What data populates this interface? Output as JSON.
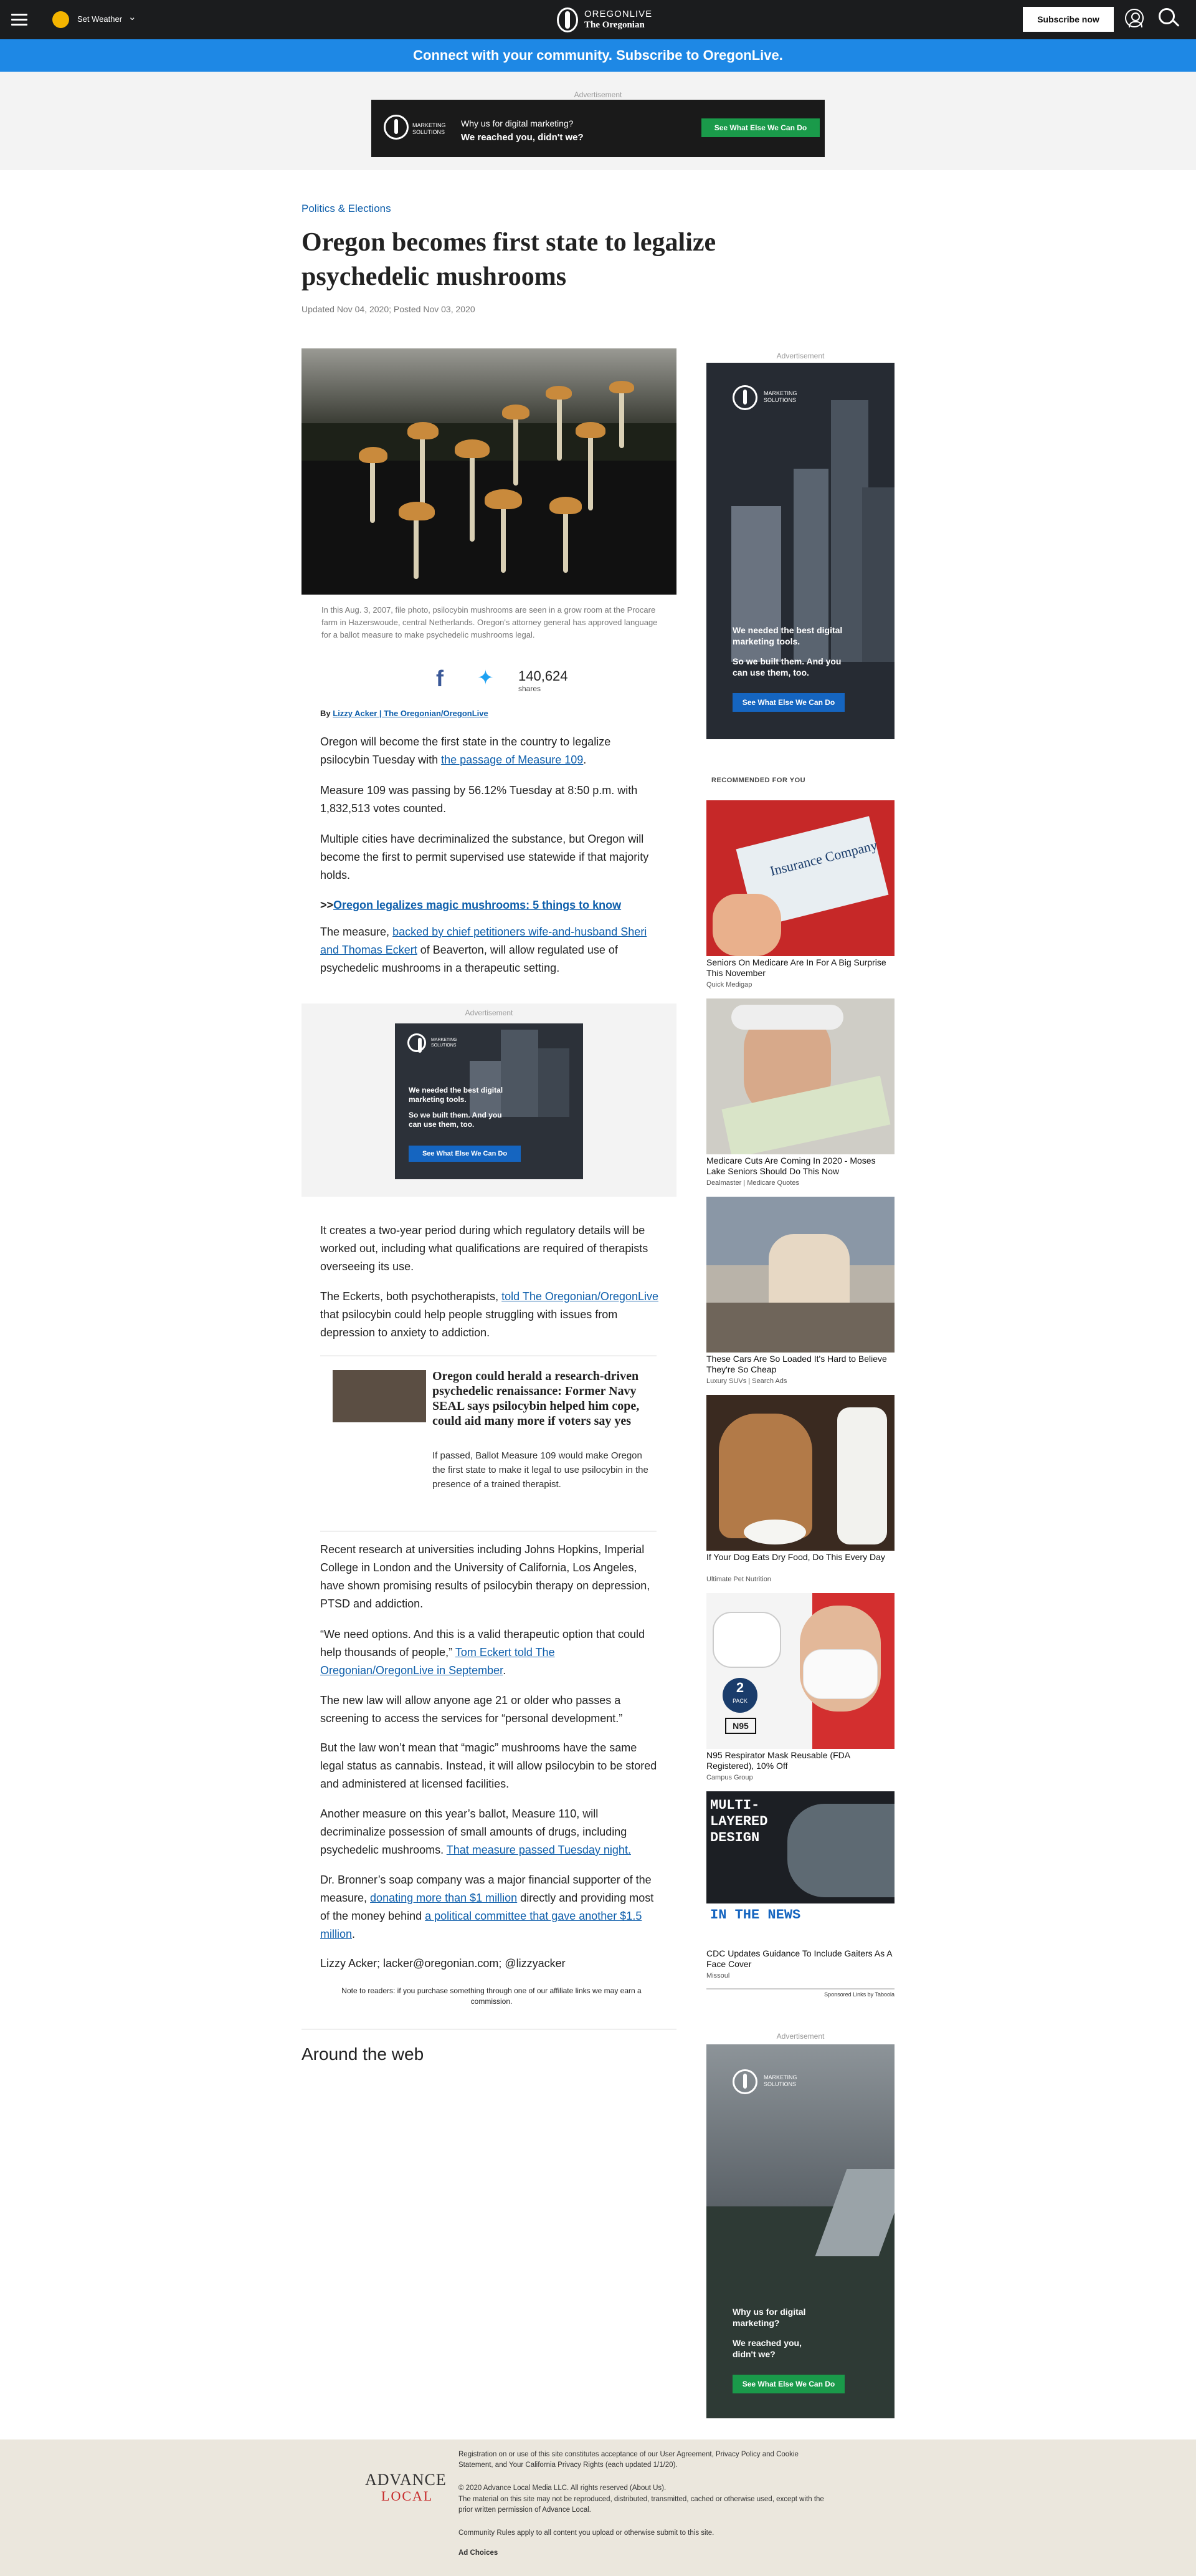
{
  "topbar": {
    "weather_label": "Set Weather",
    "logo_line1": "OREGONLIVE",
    "logo_line2": "The Oregonian",
    "subscribe_label": "Subscribe now"
  },
  "promo_bar": "Connect with your community. Subscribe to OregonLive.",
  "top_ad": {
    "label": "Advertisement",
    "brand": "MARKETING SOLUTIONS",
    "line1": "Why us for digital marketing?",
    "line2": "We reached you, didn't we?",
    "cta": "See What Else We Can Do"
  },
  "article": {
    "kicker": "Politics & Elections",
    "headline": "Oregon becomes first state to legalize psychedelic mushrooms",
    "dateline": "Updated Nov 04, 2020; Posted Nov 03, 2020",
    "caption": "In this Aug. 3, 2007, file photo, psilocybin mushrooms are seen in a grow room at the Procare farm in Hazerswoude, central Netherlands. Oregon's attorney general has approved language for a ballot measure to make psychedelic mushrooms legal.",
    "share_count": "140,624",
    "share_label": "shares",
    "by_prefix": "By",
    "by_author": "Lizzy Acker | The Oregonian/OregonLive",
    "p1_a": "Oregon will become the first state in the country to legalize psilocybin Tuesday with ",
    "p1_link": "the passage of Measure 109",
    "p1_b": ".",
    "p2": "Measure 109 was passing by 56.12% Tuesday at 8:50 p.m. with 1,832,513 votes counted.",
    "p3": "Multiple cities have decriminalized the substance, but Oregon will become the first to permit supervised use statewide if that majority holds.",
    "p4_prefix": ">>",
    "p4_link": "Oregon legalizes magic mushrooms: 5 things to know",
    "p5_a": "The measure, ",
    "p5_link": "backed by chief petitioners wife-and-husband Sheri and Thomas Eckert",
    "p5_b": " of Beaverton, will allow regulated use of psychedelic mushrooms in a therapeutic setting.",
    "p6": "It creates a two-year period during which regulatory details will be worked out, including what qualifications are required of therapists overseeing its use.",
    "p7_a": "The Eckerts, both psychotherapists, ",
    "p7_link": "told The Oregonian/OregonLive",
    "p7_b": " that psilocybin could help people struggling with issues from depression to anxiety to addiction.",
    "related_title": "Oregon could herald a research-driven psychedelic renaissance: Former Navy SEAL says psilocybin helped him cope, could aid many more if voters say yes",
    "related_summary": "If passed, Ballot Measure 109 would make Oregon the first state to make it legal to use psilocybin in the presence of a trained therapist.",
    "p8": "Recent research at universities including Johns Hopkins, Imperial College in London and the University of California, Los Angeles, have shown promising results of psilocybin therapy on depression, PTSD and addiction.",
    "p9_a": "“We need options. And this is a valid therapeutic option that could help thousands of people,” ",
    "p9_link": "Tom Eckert told The Oregonian/OregonLive in September",
    "p9_b": ".",
    "p10": "The new law will allow anyone age 21 or older who passes a screening to access the services for “personal development.”",
    "p11": "But the law won’t mean that “magic” mushrooms have the same legal status as cannabis. Instead, it will allow psilocybin to be stored and administered at licensed facilities.",
    "p12_a": "Another measure on this year’s ballot, Measure 110, will decriminalize possession of small amounts of drugs, including psychedelic mushrooms. ",
    "p12_link": "That measure passed Tuesday night.",
    "p13_a": "Dr. Bronner’s soap company was a major financial supporter of the measure, ",
    "p13_link1": "donating more than $1 million",
    "p13_b": " directly and providing most of the money behind ",
    "p13_link2": "a political committee that gave another $1.5 million",
    "p13_c": ".",
    "p14": "Lizzy Acker; lacker@oregonian.com; @lizzyacker",
    "affiliate_note": "Note to readers: if you purchase something through one of our affiliate links we may earn a commission.",
    "around_web": "Around the web"
  },
  "mid_ad": {
    "label": "Advertisement",
    "brand": "MARKETING SOLUTIONS",
    "line1": "We needed the best digital marketing tools.",
    "line2": "So we built them. And you can use them, too.",
    "cta": "See What Else We Can Do"
  },
  "side_ad1": {
    "label": "Advertisement",
    "brand": "MARKETING SOLUTIONS",
    "line1": "We needed the best digital marketing tools.",
    "line2": "So we built them. And you can use them, too.",
    "cta": "See What Else We Can Do"
  },
  "recommended": {
    "heading": "RECOMMENDED FOR YOU",
    "items": [
      {
        "title": "Seniors On Medicare Are In For A Big Surprise This November",
        "source": "Quick Medigap"
      },
      {
        "title": "Medicare Cuts Are Coming In 2020 - Moses Lake Seniors Should Do This Now",
        "source": "Dealmaster | Medicare Quotes"
      },
      {
        "title": "These Cars Are So Loaded It's Hard to Believe They're So Cheap",
        "source": "Luxury SUVs | Search Ads"
      },
      {
        "title": "If Your Dog Eats Dry Food, Do This Every Day",
        "source": "Ultimate Pet Nutrition"
      },
      {
        "title": "N95 Respirator Mask Reusable (FDA Registered), 10% Off",
        "source": "Campus Group"
      },
      {
        "title": "CDC Updates Guidance To Include Gaiters As A Face Cover",
        "source": "Missoul"
      }
    ],
    "img_text_insurance": "Insurance Company",
    "img_text_mask_num": "2",
    "img_text_mask_pack": "PACK",
    "img_text_mask_n95": "N95",
    "img_text_gaiter1": "MULTI-",
    "img_text_gaiter2": "LAYERED",
    "img_text_gaiter3": "DESIGN",
    "img_text_gaiter4": "IN THE NEWS",
    "sponsored": "Sponsored Links by Taboola"
  },
  "side_ad2": {
    "label": "Advertisement",
    "brand": "MARKETING SOLUTIONS",
    "line1": "Why us for digital marketing?",
    "line2": "We reached you, didn't we?",
    "cta": "See What Else We Can Do"
  },
  "footer": {
    "logo_line1": "ADVANCE",
    "logo_line2": "LOCAL",
    "text1": "Registration on or use of this site constitutes acceptance of our User Agreement, Privacy Policy and Cookie Statement, and Your California Privacy Rights (each updated 1/1/20).",
    "text2": "© 2020 Advance Local Media LLC. All rights reserved (About Us).",
    "text3": "The material on this site may not be reproduced, distributed, transmitted, cached or otherwise used, except with the prior written permission of Advance Local.",
    "text4": "Community Rules apply to all content you upload or otherwise submit to this site.",
    "text5": "Ad Choices"
  },
  "colors": {
    "topbar": "#1b1c1e",
    "promo": "#1e88e5",
    "link": "#0d5eab",
    "footer": "#ebe7dd"
  }
}
